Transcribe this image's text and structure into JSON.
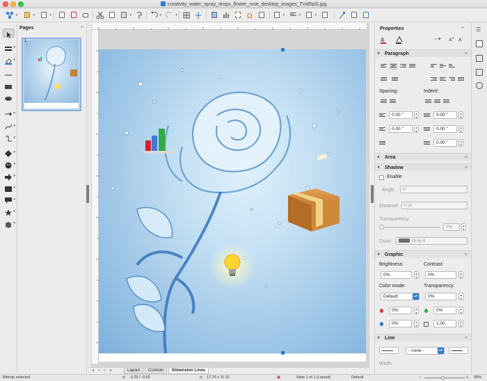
{
  "window": {
    "title": "creativity_water_spray_drops_flower_rose_desktop_images_TVid5pG.jpg"
  },
  "pages_panel": {
    "title": "Pages",
    "close": "×",
    "thumbnail_number": "1"
  },
  "tabs": {
    "nav": "◂ ◃ ▹ ▸",
    "items": [
      "Layout",
      "Controls",
      "Dimension Lines"
    ]
  },
  "status": {
    "selection": "Bitmap selected",
    "position": "-3.26 / -0.60",
    "size": "17.76 x 11.32",
    "slide": "Slide 1 of 1 (Layout)",
    "master": "Default",
    "zoom": "99%"
  },
  "properties": {
    "title": "Properties",
    "paragraph": {
      "title": "Paragraph",
      "spacing_label": "Spacing:",
      "indent_label": "Indent:",
      "above": "0.00 \"",
      "below": "0.00 \"",
      "before_indent": "0.00 \"",
      "after_indent": "0.00 \"",
      "first_line": "0.00 \""
    },
    "area": {
      "title": "Area"
    },
    "shadow": {
      "title": "Shadow",
      "enable_label": "Enable",
      "angle_label": "Angle",
      "angle_value": "0°",
      "distance_label": "Distance",
      "distance_value": "0 pt",
      "transparency_label": "Transparency:",
      "transparency_value": "0%",
      "color_label": "Color:",
      "color_value": "Gray 6"
    },
    "graphic": {
      "title": "Graphic",
      "brightness_label": "Brightness:",
      "brightness_value": "0%",
      "contrast_label": "Contrast:",
      "contrast_value": "0%",
      "color_mode_label": "Color mode:",
      "color_mode_value": "Default",
      "transparency_label": "Transparency:",
      "transparency_value": "0%",
      "red_value": "0%",
      "green_value": "0%",
      "blue_value": "0%",
      "gamma_value": "1.00"
    },
    "line": {
      "title": "Line",
      "style_value": "- none -",
      "width_label": "Width:"
    }
  },
  "colors": {
    "accent": "#2e7ad1",
    "gray6": "#6e6e6e"
  }
}
